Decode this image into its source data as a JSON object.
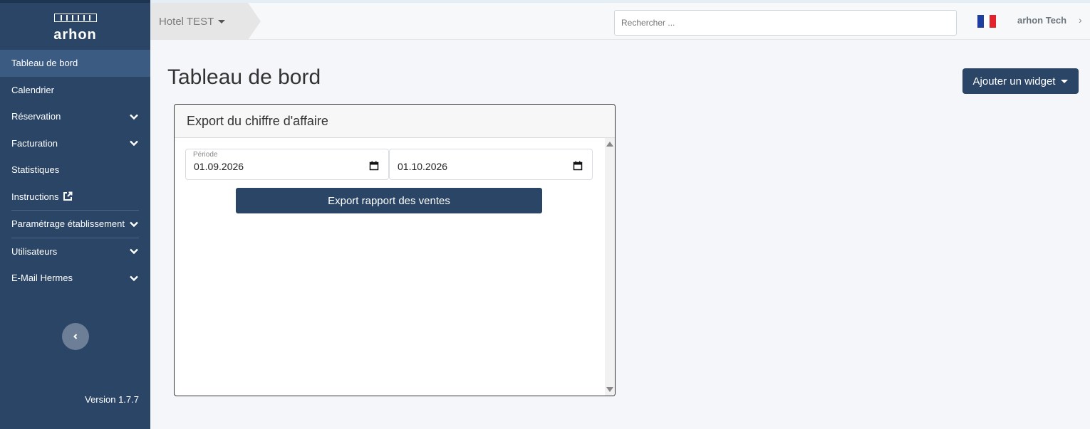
{
  "app": {
    "logo_text": "arhon",
    "version": "Version 1.7.7"
  },
  "sidebar": {
    "items": [
      {
        "label": "Tableau de bord",
        "active": true,
        "has_chevron": false
      },
      {
        "label": "Calendrier",
        "has_chevron": false
      },
      {
        "label": "Réservation",
        "has_chevron": true
      },
      {
        "label": "Facturation",
        "has_chevron": true
      },
      {
        "label": "Statistiques",
        "has_chevron": false
      },
      {
        "label": "Instructions",
        "has_chevron": false,
        "icon": "external-link-icon"
      },
      {
        "label": "Paramétrage établissement",
        "has_chevron": true
      },
      {
        "label": "Utilisateurs",
        "has_chevron": true
      },
      {
        "label": "E-Mail Hermes",
        "has_chevron": true
      }
    ],
    "collapse_icon": "chevron-left-icon"
  },
  "topbar": {
    "hotel": "Hotel TEST",
    "search_placeholder": "Rechercher ...",
    "language_flag": "flag-fr-icon",
    "user": "arhon Tech",
    "user_chevron": "›"
  },
  "main": {
    "title": "Tableau de bord",
    "add_widget_label": "Ajouter un widget"
  },
  "widget": {
    "title": "Export du chiffre d'affaire",
    "period_label": "Période",
    "date_from": "01.09.2026",
    "date_to": "01.10.2026",
    "export_label": "Export rapport des ventes"
  },
  "colors": {
    "sidebar": "#2a4566",
    "sidebar_active": "#3b5b83",
    "primary": "#2a4566"
  }
}
